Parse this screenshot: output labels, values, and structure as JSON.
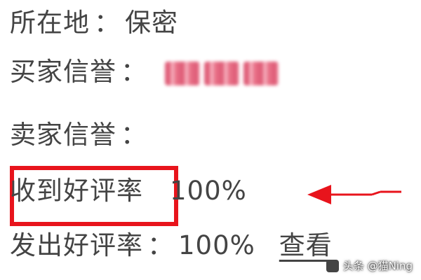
{
  "profile": {
    "location": {
      "label": "所在地",
      "colon": "：",
      "value": "保密"
    },
    "buyer_credit": {
      "label": "买家信誉",
      "colon": "：",
      "value_hidden": true
    },
    "seller_credit": {
      "label": "卖家信誉",
      "colon": "："
    },
    "received_rate": {
      "label": "收到好评率",
      "value": "100%"
    },
    "sent_rate": {
      "label": "发出好评率",
      "colon": "：",
      "value": "100%",
      "link": "查看"
    }
  },
  "annotation": {
    "highlight_color": "#e8141c",
    "arrow_color": "#e8141c"
  },
  "watermark": {
    "text": "头条 @猫Ning"
  }
}
